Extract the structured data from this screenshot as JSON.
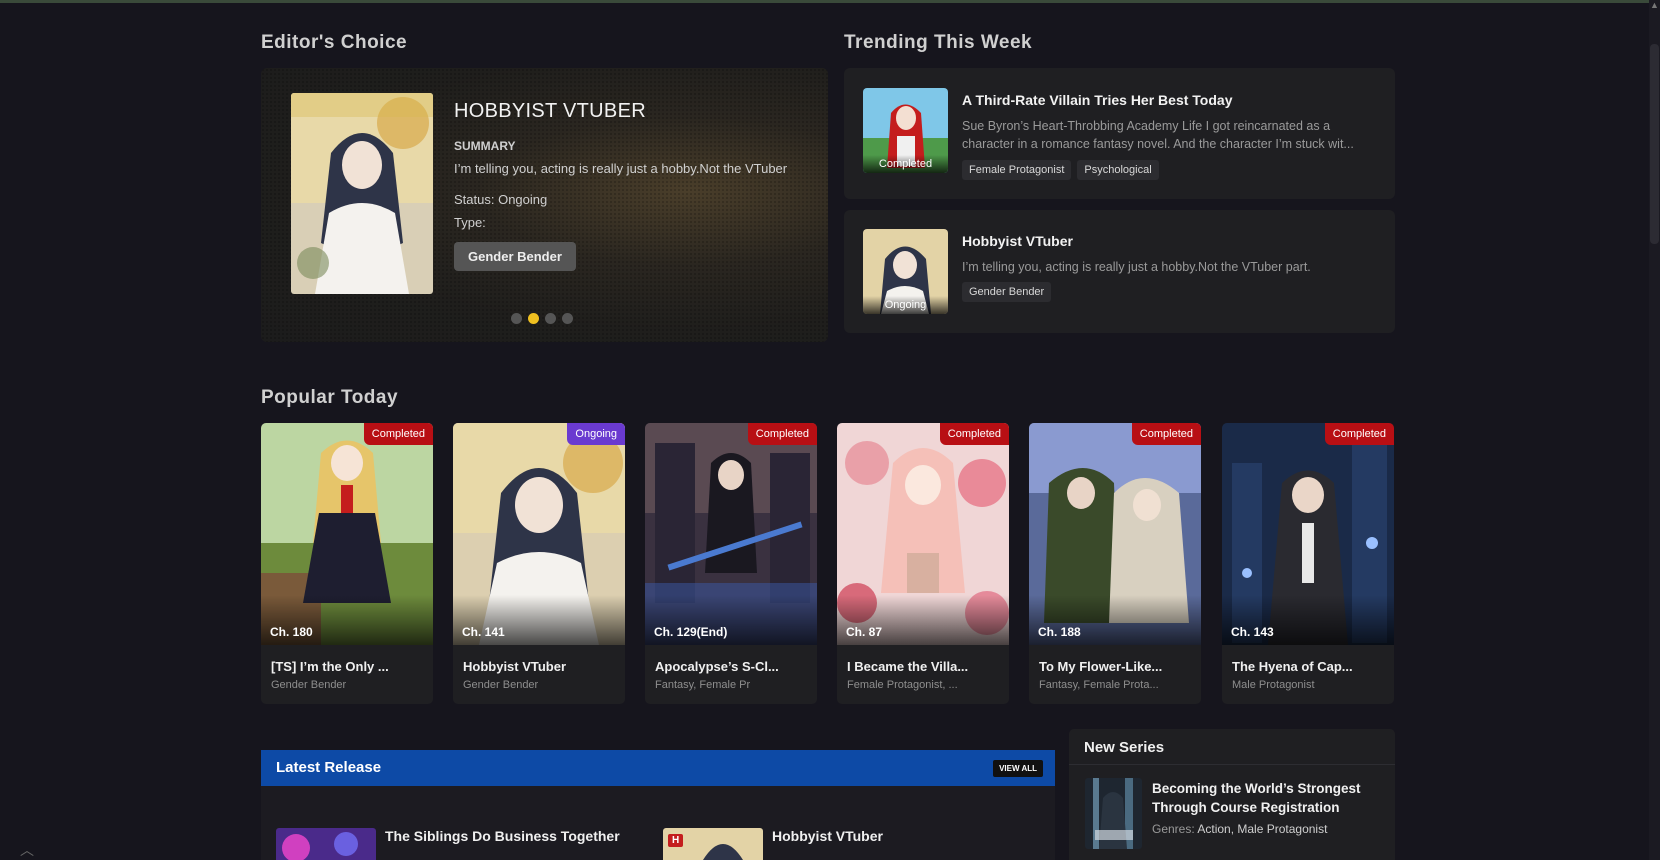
{
  "editors_choice": {
    "heading": "Editor's Choice",
    "title": "HOBBYIST VTUBER",
    "summary_label": "SUMMARY",
    "summary": "I’m telling you, acting is really just a hobby.Not the VTuber",
    "status_text": "Status: Ongoing",
    "type_text": "Type:",
    "genre": "Gender Bender",
    "slides": 4,
    "active_slide": 2
  },
  "trending": {
    "heading": "Trending This Week",
    "items": [
      {
        "title": "A Third-Rate Villain Tries Her Best Today",
        "status": "Completed",
        "desc": "Sue Byron’s Heart-Throbbing Academy Life I got reincarnated as a character in a romance fantasy novel. And the character I’m stuck wit...",
        "tags": [
          "Female Protagonist",
          "Psychological"
        ]
      },
      {
        "title": "Hobbyist VTuber",
        "status": "Ongoing",
        "desc": "I’m telling you, acting is really just a hobby.Not the VTuber part.",
        "tags": [
          "Gender Bender"
        ]
      }
    ]
  },
  "popular": {
    "heading": "Popular Today",
    "items": [
      {
        "badge": "Completed",
        "chapter": "Ch. 180",
        "title": "[TS] I’m the Only ...",
        "genres": "Gender Bender"
      },
      {
        "badge": "Ongoing",
        "chapter": "Ch. 141",
        "title": "Hobbyist VTuber",
        "genres": "Gender Bender"
      },
      {
        "badge": "Completed",
        "chapter": "Ch. 129(End)",
        "title": "Apocalypse’s S-Cl...",
        "genres": "Fantasy, Female Pr"
      },
      {
        "badge": "Completed",
        "chapter": "Ch. 87",
        "title": "I Became the Villa...",
        "genres": "Female Protagonist, ..."
      },
      {
        "badge": "Completed",
        "chapter": "Ch. 188",
        "title": "To My Flower-Like...",
        "genres": "Fantasy, Female Prota..."
      },
      {
        "badge": "Completed",
        "chapter": "Ch. 143",
        "title": "The Hyena of Cap...",
        "genres": "Male Protagonist"
      }
    ]
  },
  "latest": {
    "heading": "Latest Release",
    "view_all": "VIEW ALL",
    "items": [
      {
        "title": "The Siblings Do Business Together"
      },
      {
        "title": "Hobbyist VTuber",
        "badge": "H"
      }
    ]
  },
  "new_series": {
    "heading": "New Series",
    "item": {
      "title": "Becoming the World’s Strongest Through Course Registration",
      "genres_label": "Genres:",
      "genres": "Action, Male Protagonist"
    }
  },
  "colors": {
    "completed": "#b80f14",
    "ongoing": "#6a3ad0",
    "accent_yellow": "#f0c020",
    "latest_header": "#0d4aa6"
  }
}
